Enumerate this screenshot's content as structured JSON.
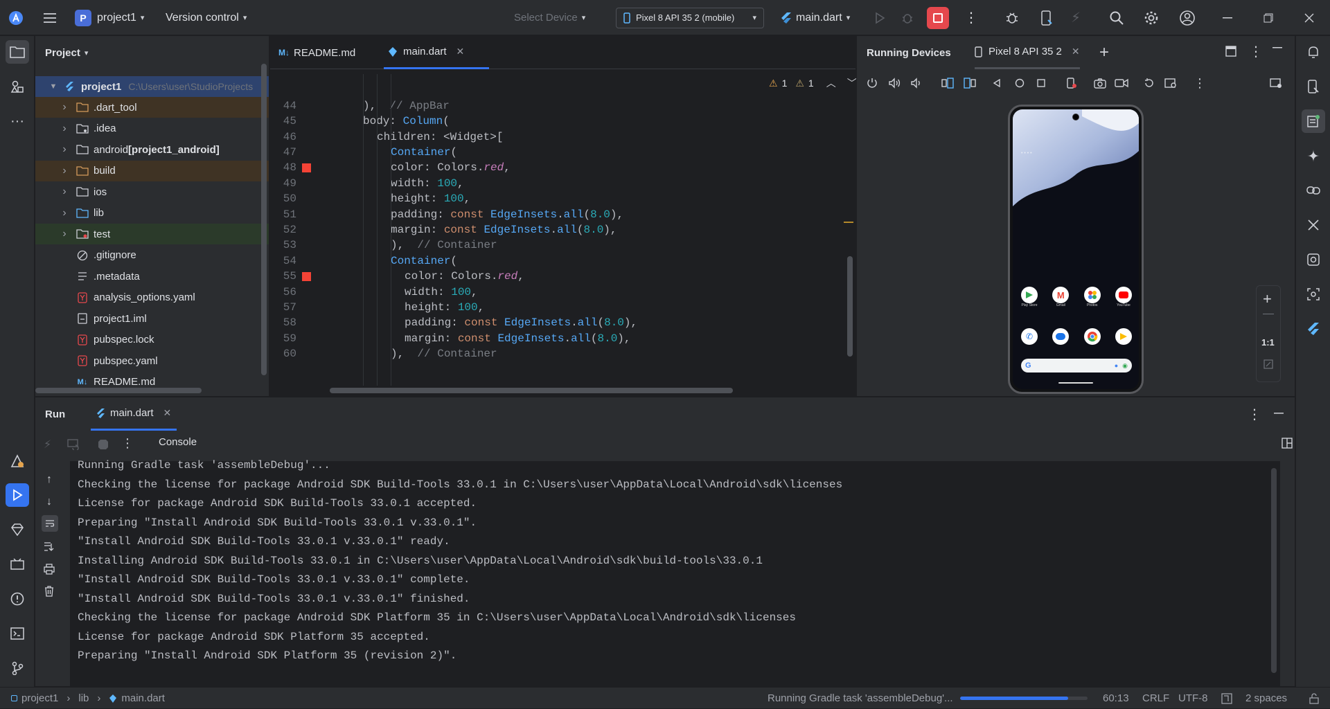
{
  "titlebar": {
    "project_name": "project1",
    "project_badge": "P",
    "version_control": "Version control",
    "select_device": "Select Device",
    "device": "Pixel 8 API 35 2 (mobile)",
    "run_config": "main.dart",
    "stop_color": "#e5484d"
  },
  "project_panel": {
    "title": "Project",
    "root_name": "project1",
    "root_path": "C:\\Users\\user\\StudioProjects",
    "items": [
      {
        "label": ".dart_tool",
        "bold_suffix": ""
      },
      {
        "label": ".idea",
        "bold_suffix": ""
      },
      {
        "label": "android ",
        "bold_suffix": "[project1_android]"
      },
      {
        "label": "build",
        "bold_suffix": ""
      },
      {
        "label": "ios",
        "bold_suffix": ""
      },
      {
        "label": "lib",
        "bold_suffix": ""
      },
      {
        "label": "test",
        "bold_suffix": ""
      },
      {
        "label": ".gitignore",
        "bold_suffix": ""
      },
      {
        "label": ".metadata",
        "bold_suffix": ""
      },
      {
        "label": "analysis_options.yaml",
        "bold_suffix": ""
      },
      {
        "label": "project1.iml",
        "bold_suffix": ""
      },
      {
        "label": "pubspec.lock",
        "bold_suffix": ""
      },
      {
        "label": "pubspec.yaml",
        "bold_suffix": ""
      },
      {
        "label": "README.md",
        "bold_suffix": ""
      }
    ]
  },
  "editor": {
    "tabs": [
      {
        "label": "README.md",
        "badge": "M↓"
      },
      {
        "label": "main.dart",
        "badge": ""
      }
    ],
    "warnings_a": "1",
    "warnings_b": "1",
    "lines": [
      {
        "n": "44",
        "code": "),  // AppBar"
      },
      {
        "n": "45",
        "code": "body: Column("
      },
      {
        "n": "46",
        "code": "children: <Widget>["
      },
      {
        "n": "47",
        "code": "Container("
      },
      {
        "n": "48",
        "code": "color: Colors.red,"
      },
      {
        "n": "49",
        "code": "width: 100,"
      },
      {
        "n": "50",
        "code": "height: 100,"
      },
      {
        "n": "51",
        "code": "padding: const EdgeInsets.all(8.0),"
      },
      {
        "n": "52",
        "code": "margin: const EdgeInsets.all(8.0),"
      },
      {
        "n": "53",
        "code": "),  // Container"
      },
      {
        "n": "54",
        "code": "Container("
      },
      {
        "n": "55",
        "code": "color: Colors.red,"
      },
      {
        "n": "56",
        "code": "width: 100,"
      },
      {
        "n": "57",
        "code": "height: 100,"
      },
      {
        "n": "58",
        "code": "padding: const EdgeInsets.all(8.0),"
      },
      {
        "n": "59",
        "code": "margin: const EdgeInsets.all(8.0),"
      },
      {
        "n": "60",
        "code": "),  // Container"
      }
    ]
  },
  "devices": {
    "title": "Running Devices",
    "tab": "Pixel 8 API 35 2",
    "zoom": "1:1",
    "apps_row1": [
      "Play Store",
      "Gmail",
      "Photos",
      "YouTube"
    ]
  },
  "run": {
    "title": "Run",
    "tab": "main.dart",
    "console_label": "Console",
    "lines": [
      "Running Gradle task 'assembleDebug'...",
      "Checking the license for package Android SDK Build-Tools 33.0.1 in C:\\Users\\user\\AppData\\Local\\Android\\sdk\\licenses",
      "License for package Android SDK Build-Tools 33.0.1 accepted.",
      "Preparing \"Install Android SDK Build-Tools 33.0.1 v.33.0.1\".",
      "\"Install Android SDK Build-Tools 33.0.1 v.33.0.1\" ready.",
      "Installing Android SDK Build-Tools 33.0.1 in C:\\Users\\user\\AppData\\Local\\Android\\sdk\\build-tools\\33.0.1",
      "\"Install Android SDK Build-Tools 33.0.1 v.33.0.1\" complete.",
      "\"Install Android SDK Build-Tools 33.0.1 v.33.0.1\" finished.",
      "Checking the license for package Android SDK Platform 35 in C:\\Users\\user\\AppData\\Local\\Android\\sdk\\licenses",
      "License for package Android SDK Platform 35 accepted.",
      "Preparing \"Install Android SDK Platform 35 (revision 2)\"."
    ]
  },
  "status": {
    "crumb_project": "project1",
    "crumb_lib": "lib",
    "crumb_file": "main.dart",
    "task": "Running Gradle task 'assembleDebug'...",
    "progress": 0.85,
    "position": "60:13",
    "line_sep": "CRLF",
    "encoding": "UTF-8",
    "indent": "2 spaces"
  }
}
